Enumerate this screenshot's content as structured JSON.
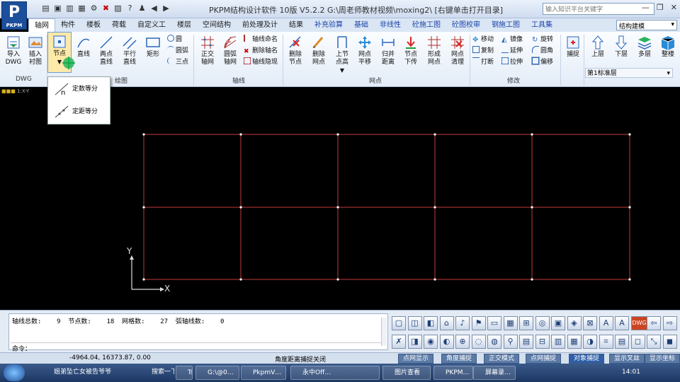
{
  "titlebar": {
    "logo": "P",
    "logo_sub": "PKPM",
    "title": "PKPM结构设计软件 10版 V5.2.2 G:\\周老师教材视频\\moxing2\\  [右键单击打开目录]",
    "search_placeholder": "输入知识平台关键字"
  },
  "tabs": [
    {
      "label": "轴网",
      "active": true
    },
    {
      "label": "构件"
    },
    {
      "label": "楼板"
    },
    {
      "label": "荷载"
    },
    {
      "label": "自定义工"
    },
    {
      "label": "楼层"
    },
    {
      "label": "空间结构"
    },
    {
      "label": "前处理及计"
    },
    {
      "label": "结果"
    },
    {
      "label": "补充验算",
      "blue": true
    },
    {
      "label": "基础",
      "blue": true
    },
    {
      "label": "非线性",
      "blue": true
    },
    {
      "label": "砼施工图",
      "blue": true
    },
    {
      "label": "砼图校审",
      "blue": true
    },
    {
      "label": "钢施工图",
      "blue": true
    },
    {
      "label": "工具集",
      "blue": true
    }
  ],
  "mode_select": "结构建模",
  "ribbon": {
    "dwg": {
      "import": "导入\nDWG",
      "insert": "插入\n衬图",
      "group": "DWG"
    },
    "draw": {
      "node": "节点",
      "line": "直线",
      "twopoint": "两点\n直线",
      "parallel": "平行\n直线",
      "rect": "矩形",
      "circle": "圆",
      "arc": "圆弧",
      "threepoint": "三点",
      "group": "绘图"
    },
    "axis": {
      "ortho": "正交\n轴网",
      "arcgrid": "圆弧\n轴网",
      "name": "轴线命名",
      "delname": "删除轴名",
      "hide": "轴线隐现",
      "group": "轴线"
    },
    "grid": {
      "delnode": "删除\n节点",
      "delgrid": "删除\n网点",
      "upnode": "上节\n点高",
      "move": "网点\n平移",
      "merge": "归并\n距离",
      "down": "节点\n下传",
      "form": "形成\n网点",
      "clear": "网点\n清理",
      "group": "网点"
    },
    "modify": {
      "move": "移动",
      "mirror": "镜像",
      "rotate": "旋转",
      "copy": "复制",
      "extend": "延伸",
      "fillet": "圆角",
      "break": "打断",
      "stretch": "拉伸",
      "offset": "偏移",
      "group": "修改"
    },
    "snap": {
      "label": "捕捉"
    },
    "floor": {
      "up": "上层",
      "down": "下层",
      "multi": "多层",
      "whole": "整楼",
      "current": "第1标准层"
    }
  },
  "popup": {
    "items": [
      "定数等分",
      "定距等分"
    ]
  },
  "canvas": {
    "viewport_tag": "1:X-Y",
    "axis_x": "X",
    "axis_y": "Y"
  },
  "stats": {
    "text": "轴线总数:    9  节点数:    18  网格数:    27  弧轴线数:    0"
  },
  "command_prompt": "命令：",
  "status": {
    "coords": "-4964.04, 16373.87, 0.00",
    "message": "角度距离捕捉关闭",
    "buttons": [
      "点网显示",
      "角度捕捉",
      "正交模式",
      "点网捕捉",
      "对象捕捉",
      "显示叉丝",
      "显示坐标"
    ]
  },
  "taskbar": {
    "items": [
      "姐弟坠亡女被告爷爷",
      "搜索一下",
      "Tssd20…",
      "G:\\@0…",
      "PkpmV…",
      "永中Off…",
      "图片查看",
      "PKPM…",
      "屏幕录…"
    ],
    "clock": "14:01"
  },
  "colors": {
    "grid_line": "#c23a3a",
    "node": "#ffffff",
    "accent": "#2f5fa8"
  }
}
